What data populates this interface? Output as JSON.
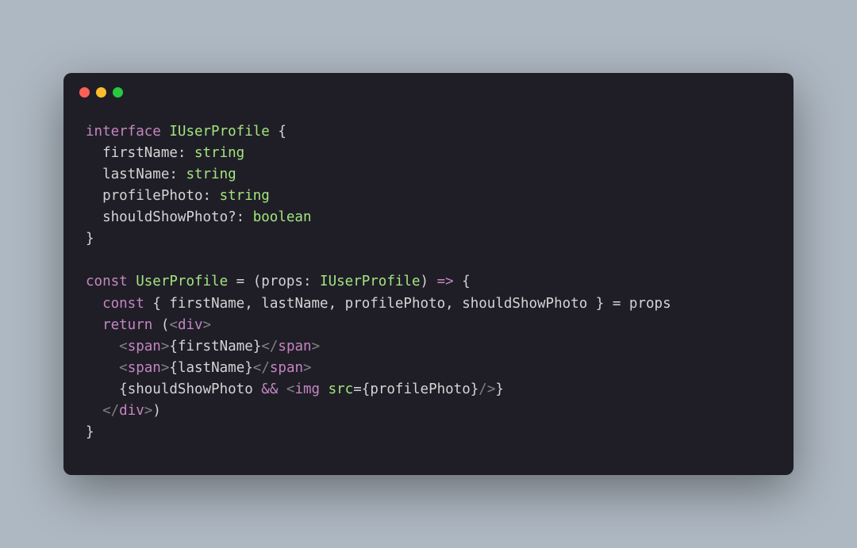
{
  "code": {
    "l1": {
      "kw": "interface",
      "type": "IUserProfile",
      "brace": " {"
    },
    "l2": {
      "indent": "  ",
      "prop": "firstName",
      "colon": ": ",
      "ptype": "string"
    },
    "l3": {
      "indent": "  ",
      "prop": "lastName",
      "colon": ": ",
      "ptype": "string"
    },
    "l4": {
      "indent": "  ",
      "prop": "profilePhoto",
      "colon": ": ",
      "ptype": "string"
    },
    "l5": {
      "indent": "  ",
      "prop": "shouldShowPhoto?",
      "colon": ": ",
      "ptype": "boolean"
    },
    "l6": {
      "brace": "}"
    },
    "l7": {
      "blank": ""
    },
    "l8": {
      "kw": "const",
      "name": " UserProfile ",
      "eq": "= ",
      "paren1": "(",
      "param": "props",
      "colon": ": ",
      "ptype": "IUserProfile",
      "paren2": ") ",
      "arrow": "=>",
      "brace": " {"
    },
    "l9": {
      "indent": "  ",
      "kw": "const",
      "space": " ",
      "lbrace": "{ ",
      "d1": "firstName",
      "c1": ", ",
      "d2": "lastName",
      "c2": ", ",
      "d3": "profilePhoto",
      "c3": ", ",
      "d4": "shouldShowPhoto",
      "rbrace": " } ",
      "eq": "= ",
      "src": "props"
    },
    "l10": {
      "indent": "  ",
      "kw": "return",
      "space": " ",
      "paren": "(",
      "lt": "<",
      "tag": "div",
      "gt": ">"
    },
    "l11": {
      "indent": "    ",
      "lt1": "<",
      "tag1": "span",
      "gt1": ">",
      "jbo": "{",
      "expr": "firstName",
      "jbc": "}",
      "lt2": "</",
      "tag2": "span",
      "gt2": ">"
    },
    "l12": {
      "indent": "    ",
      "lt1": "<",
      "tag1": "span",
      "gt1": ">",
      "jbo": "{",
      "expr": "lastName",
      "jbc": "}",
      "lt2": "</",
      "tag2": "span",
      "gt2": ">"
    },
    "l13": {
      "indent": "    ",
      "jbo": "{",
      "cond": "shouldShowPhoto ",
      "op": "&&",
      "sp": " ",
      "lt": "<",
      "tag": "img",
      "sp2": " ",
      "attr": "src",
      "eq": "=",
      "jbo2": "{",
      "val": "profilePhoto",
      "jbc2": "}",
      "slash": "/",
      "gt": ">",
      "jbc": "}"
    },
    "l14": {
      "indent": "  ",
      "lt": "</",
      "tag": "div",
      "gt": ">",
      "paren": ")"
    },
    "l15": {
      "brace": "}"
    }
  }
}
